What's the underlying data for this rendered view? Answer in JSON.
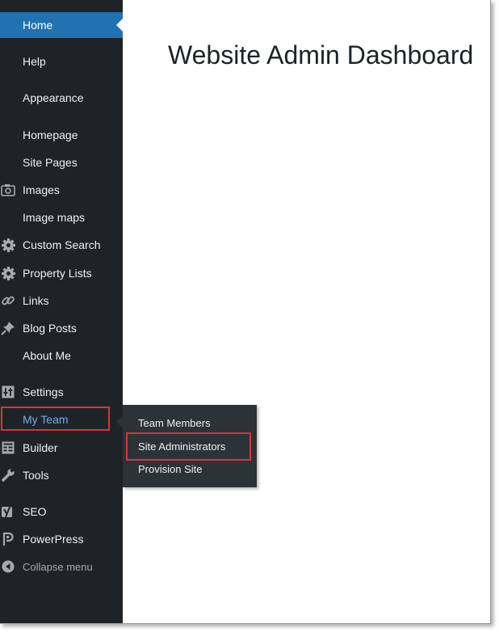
{
  "page": {
    "title": "Website Admin Dashboard"
  },
  "sidebar": {
    "items": [
      {
        "label": "Home",
        "icon": "home-icon"
      },
      {
        "label": "Help",
        "icon": "help-icon"
      },
      {
        "label": "Appearance",
        "icon": "appearance-icon"
      },
      {
        "label": "Homepage",
        "icon": "homepage-icon"
      },
      {
        "label": "Site Pages",
        "icon": "pages-icon"
      },
      {
        "label": "Images",
        "icon": "camera-icon"
      },
      {
        "label": "Image maps",
        "icon": "image-map-icon"
      },
      {
        "label": "Custom Search",
        "icon": "gear-icon"
      },
      {
        "label": "Property Lists",
        "icon": "gear-icon"
      },
      {
        "label": "Links",
        "icon": "link-icon"
      },
      {
        "label": "Blog Posts",
        "icon": "pin-icon"
      },
      {
        "label": "About Me",
        "icon": "about-icon"
      },
      {
        "label": "Settings",
        "icon": "sliders-icon"
      },
      {
        "label": "My Team",
        "icon": "team-icon"
      },
      {
        "label": "Builder",
        "icon": "builder-grid-icon"
      },
      {
        "label": "Tools",
        "icon": "wrench-icon"
      },
      {
        "label": "SEO",
        "icon": "yoast-seo-icon"
      },
      {
        "label": "PowerPress",
        "icon": "powerpress-icon"
      }
    ],
    "collapse_label": "Collapse menu"
  },
  "flyout": {
    "items": [
      {
        "label": "Team Members"
      },
      {
        "label": "Site Administrators"
      },
      {
        "label": "Provision Site"
      }
    ]
  },
  "colors": {
    "sidebar_bg": "#1d2327",
    "active_bg": "#2271b1",
    "highlight_red": "#d63638",
    "team_text": "#72aee6",
    "flyout_bg": "#2c3338"
  }
}
